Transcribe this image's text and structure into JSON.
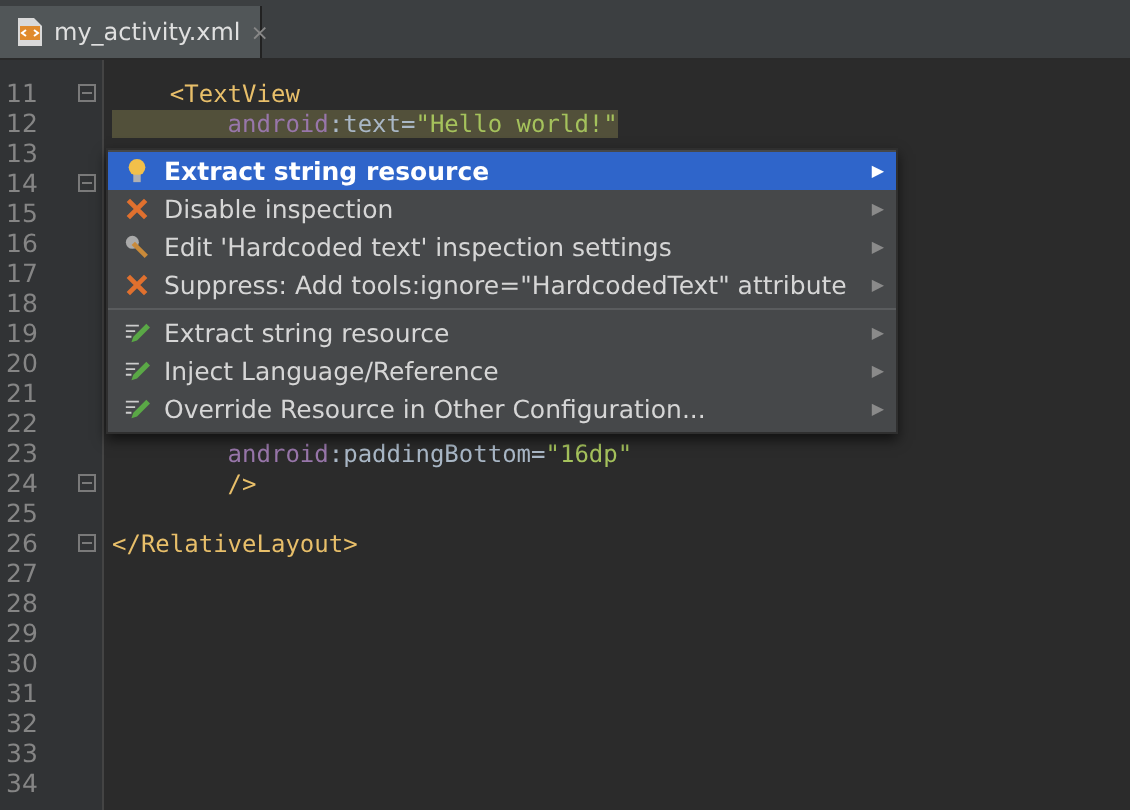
{
  "tabs": [
    {
      "label": "my_activity.xml",
      "close": "×",
      "selected": true
    }
  ],
  "editor": {
    "lines": [
      {
        "number": "11",
        "fold": true,
        "tokens": [
          {
            "kind": "tag",
            "text": "    <TextView"
          }
        ]
      },
      {
        "number": "12",
        "tokens": [
          {
            "kind": "ns",
            "text": "        android",
            "warn": true
          },
          {
            "kind": "attr",
            "text": ":text=",
            "warn": true
          },
          {
            "kind": "value",
            "text": "\"Hello world!\"",
            "warn": true
          }
        ]
      },
      {
        "number": "13"
      },
      {
        "number": "14",
        "fold": true
      },
      {
        "number": "15"
      },
      {
        "number": "16"
      },
      {
        "number": "17"
      },
      {
        "number": "18"
      },
      {
        "number": "19"
      },
      {
        "number": "20"
      },
      {
        "number": "21"
      },
      {
        "number": "22"
      },
      {
        "number": "23",
        "tokens": [
          {
            "kind": "ns",
            "text": "        android"
          },
          {
            "kind": "attr",
            "text": ":paddingBottom="
          },
          {
            "kind": "value",
            "text": "\"16dp\""
          }
        ]
      },
      {
        "number": "24",
        "fold": true,
        "tokens": [
          {
            "kind": "tag",
            "text": "        />"
          }
        ]
      },
      {
        "number": "25"
      },
      {
        "number": "26",
        "fold": true,
        "tokens": [
          {
            "kind": "tag",
            "text": "</RelativeLayout>"
          }
        ]
      },
      {
        "number": "27"
      },
      {
        "number": "28"
      },
      {
        "number": "29"
      },
      {
        "number": "30"
      },
      {
        "number": "31"
      },
      {
        "number": "32"
      },
      {
        "number": "33"
      },
      {
        "number": "34"
      }
    ]
  },
  "menu": {
    "sections": [
      [
        {
          "kind": "bulb",
          "label": "Extract string resource",
          "arrow": "▶",
          "selected": true
        },
        {
          "kind": "cross",
          "label": "Disable inspection",
          "arrow": "▶",
          "selected": false
        },
        {
          "kind": "wrench",
          "label": "Edit 'Hardcoded text' inspection settings",
          "arrow": "▶",
          "selected": false
        },
        {
          "kind": "cross",
          "label": "Suppress: Add tools:ignore=\"HardcodedText\" attribute",
          "arrow": "▶",
          "selected": false
        }
      ],
      [
        {
          "kind": "pencil",
          "label": "Extract string resource",
          "arrow": "▶",
          "selected": false
        },
        {
          "kind": "pencil",
          "label": "Inject Language/Reference",
          "arrow": "▶",
          "selected": false
        },
        {
          "kind": "pencil",
          "label": "Override Resource in Other Configuration...",
          "arrow": "▶",
          "selected": false
        }
      ]
    ]
  }
}
